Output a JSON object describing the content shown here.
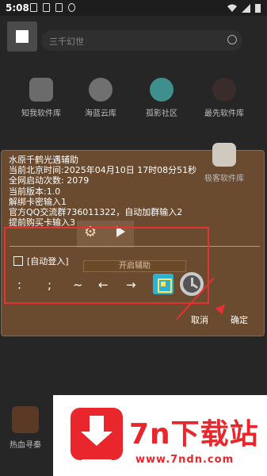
{
  "status_bar": {
    "time": "5:08"
  },
  "background_app": {
    "search_placeholder": "三千幻世",
    "apps_row1": [
      {
        "label": "知我软件库"
      },
      {
        "label": "海蓝云库"
      },
      {
        "label": "孤影社区"
      },
      {
        "label": "最先软件库"
      }
    ],
    "apps_row2": [
      {
        "label": "极客软件库"
      }
    ],
    "bottom_app": {
      "label": "热血寻秦"
    }
  },
  "dialog": {
    "info_lines": [
      "水原千鹤光遇辅助",
      "当前北京时间:2025年04月10日 17时08分51秒",
      "全网启动次数: 2079",
      "当前版本:1.0",
      "解绑卡密输入1",
      "官方QQ交流群736011322，自动加群输入2",
      "提前购买卡输入3"
    ],
    "auto_login_label": "[自动登入]",
    "start_button_label": "开启辅助",
    "symbols": [
      ":",
      ";",
      "~",
      "←",
      "→"
    ],
    "cancel_label": "取消",
    "confirm_label": "确定"
  },
  "watermark": {
    "title": "7n下载站",
    "url": "www.7ndn.com",
    "accent_color": "#e8262b"
  },
  "colors": {
    "dialog_bg": "#6e4e30",
    "highlight_red": "#e53131"
  }
}
